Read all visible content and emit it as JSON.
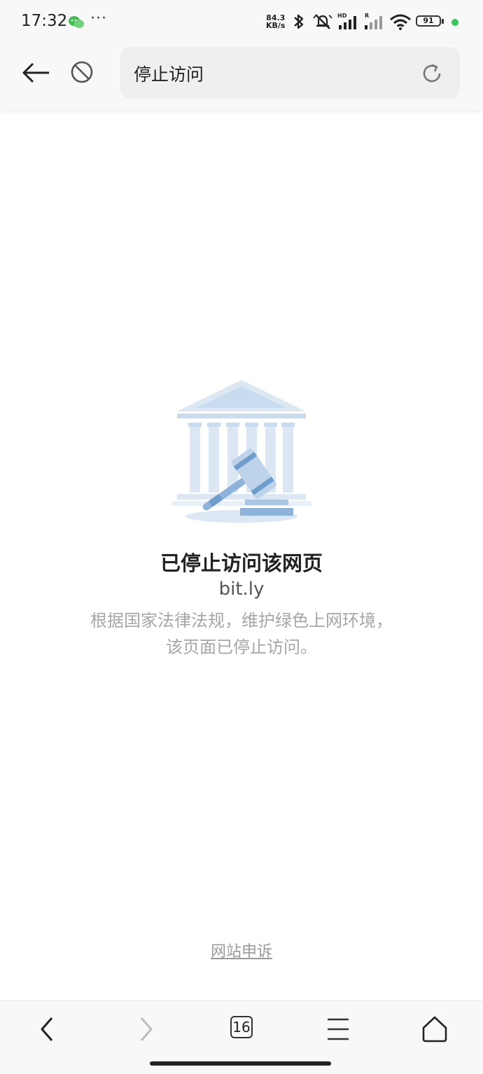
{
  "status_bar": {
    "time": "17:32",
    "more": "···",
    "net_speed_value": "84.3",
    "net_speed_unit": "KB/s",
    "hd_label": "HD",
    "roaming_label": "R",
    "battery_level": "91",
    "icons": [
      "wechat-icon",
      "bluetooth-icon",
      "mute-icon",
      "signal-icon",
      "wifi-icon",
      "battery-icon"
    ]
  },
  "address_bar": {
    "url_text": "停止访问"
  },
  "main": {
    "title": "已停止访问该网页",
    "domain": "bit.ly",
    "description_line1": "根据国家法律法规，维护绿色上网环境，",
    "description_line2": "该页面已停止访问。",
    "appeal_link": "网站申诉"
  },
  "bottom_nav": {
    "tab_count": "16"
  },
  "colors": {
    "illustration_light": "#dbe7f3",
    "illustration_mid": "#a9c6e4",
    "illustration_dark": "#6e9dcd",
    "status_dot": "#37c75a"
  }
}
